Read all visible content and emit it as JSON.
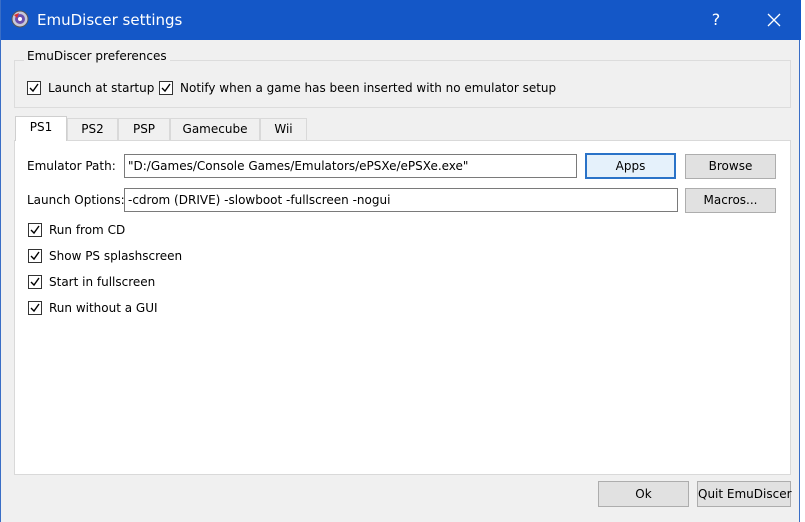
{
  "window": {
    "title": "EmuDiscer settings",
    "help_label": "?"
  },
  "preferences": {
    "group_title": "EmuDiscer preferences",
    "launch_at_startup": {
      "label": "Launch at startup",
      "checked": true
    },
    "notify_no_emulator": {
      "label": "Notify when a game has been inserted with no emulator setup",
      "checked": true
    }
  },
  "tabs": [
    {
      "label": "PS1",
      "active": true
    },
    {
      "label": "PS2",
      "active": false
    },
    {
      "label": "PSP",
      "active": false
    },
    {
      "label": "Gamecube",
      "active": false
    },
    {
      "label": "Wii",
      "active": false
    }
  ],
  "ps1": {
    "emulator_path_label": "Emulator Path:",
    "emulator_path_value": "\"D:/Games/Console Games/Emulators/ePSXe/ePSXe.exe\"",
    "apps_button": "Apps",
    "browse_button": "Browse",
    "launch_options_label": "Launch Options:",
    "launch_options_value": "-cdrom (DRIVE) -slowboot -fullscreen -nogui",
    "macros_button": "Macros...",
    "options": [
      {
        "label": "Run from CD",
        "checked": true
      },
      {
        "label": "Show PS splashscreen",
        "checked": true
      },
      {
        "label": "Start in fullscreen",
        "checked": true
      },
      {
        "label": "Run without a GUI",
        "checked": true
      }
    ]
  },
  "footer": {
    "ok_button": "Ok",
    "quit_button": "Quit EmuDiscer"
  },
  "colors": {
    "titlebar": "#1457c7",
    "focus_border": "#2a73c8"
  }
}
